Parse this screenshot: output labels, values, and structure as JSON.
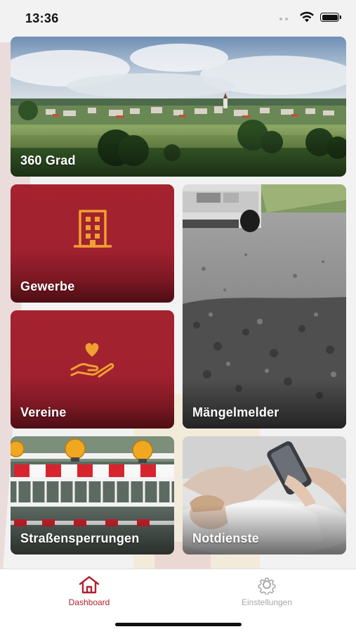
{
  "status_bar": {
    "time": "13:36",
    "battery_icon": "battery-full-icon",
    "wifi_icon": "wifi-icon"
  },
  "tiles": {
    "panorama": {
      "label": "360 Grad"
    },
    "gewerbe": {
      "label": "Gewerbe",
      "icon": "office-building-icon"
    },
    "vereine": {
      "label": "Vereine",
      "icon": "heart-in-hand-icon"
    },
    "maengelmelder": {
      "label": "Mängelmelder"
    },
    "strassensperrungen": {
      "label": "Straßensperrungen"
    },
    "notdienste": {
      "label": "Notdienste"
    }
  },
  "tabbar": {
    "items": [
      {
        "label": "Dashboard",
        "icon": "home-icon",
        "active": true
      },
      {
        "label": "Einstellungen",
        "icon": "gear-icon",
        "active": false
      }
    ]
  },
  "colors": {
    "accent": "#b0212f",
    "tile_red": "#a4232f",
    "icon_orange": "#f0a030",
    "inactive": "#a8a8a8"
  }
}
